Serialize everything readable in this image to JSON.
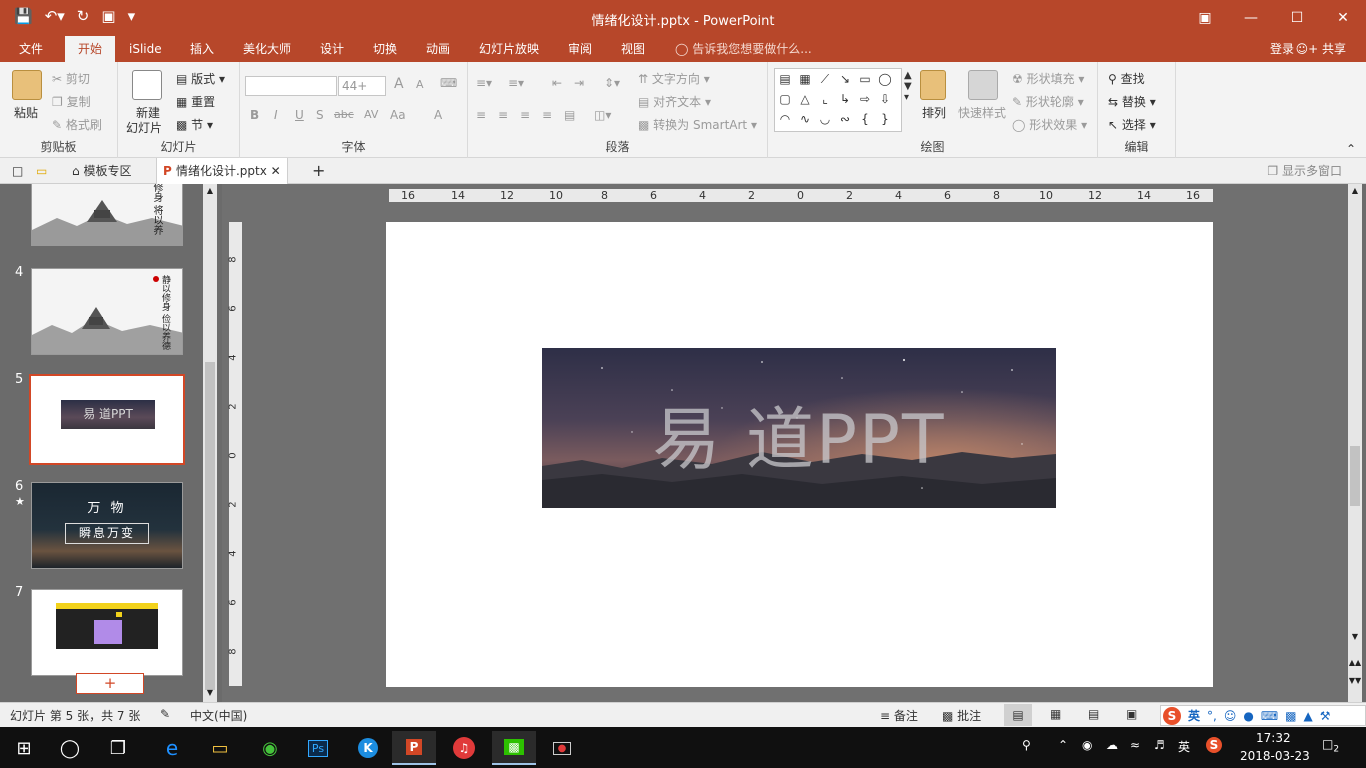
{
  "window": {
    "title": "情绪化设计.pptx - PowerPoint"
  },
  "ribbon_tabs": [
    "文件",
    "开始",
    "iSlide",
    "插入",
    "美化大师",
    "设计",
    "切换",
    "动画",
    "幻灯片放映",
    "审阅",
    "视图"
  ],
  "active_tab": "开始",
  "tell_me": "告诉我您想要做什么...",
  "account": {
    "login": "登录",
    "share": "共享"
  },
  "clipboard": {
    "paste": "粘贴",
    "cut": "剪切",
    "copy": "复制",
    "format_painter": "格式刷",
    "label": "剪贴板"
  },
  "slides_group": {
    "new_slide_line1": "新建",
    "new_slide_line2": "幻灯片",
    "layout": "版式",
    "reset": "重置",
    "section": "节",
    "label": "幻灯片"
  },
  "font_group": {
    "font_size": "44+",
    "label": "字体",
    "bold": "B",
    "italic": "I",
    "underline": "U",
    "shadow": "S",
    "strike": "abc",
    "spacing": "AV",
    "case": "Aa",
    "color": "A",
    "grow": "A",
    "shrink": "A"
  },
  "paragraph_group": {
    "text_direction": "文字方向",
    "align_text": "对齐文本",
    "convert_smartart": "转换为 SmartArt",
    "label": "段落"
  },
  "drawing_group": {
    "arrange": "排列",
    "quick_styles": "快速样式",
    "shape_fill": "形状填充",
    "shape_outline": "形状轮廓",
    "shape_effects": "形状效果",
    "label": "绘图"
  },
  "editing_group": {
    "find": "查找",
    "replace": "替换",
    "select": "选择",
    "label": "编辑"
  },
  "doc_tabs": {
    "templates": "模板专区",
    "file": "情绪化设计.pptx",
    "multi_window": "显示多窗口",
    "new_tab": "+"
  },
  "thumbnails": [
    {
      "num": "",
      "kind": "ink-landscape",
      "poem": "将以修身 将以养德"
    },
    {
      "num": "4",
      "kind": "ink-landscape",
      "poem": "静以修身 俭以养德"
    },
    {
      "num": "5",
      "kind": "banner",
      "text": "易 道PPT",
      "active": true
    },
    {
      "num": "6",
      "kind": "dusk",
      "title": "万 物",
      "subtitle": "瞬息万变",
      "star": "★"
    },
    {
      "num": "7",
      "kind": "screenshot"
    }
  ],
  "add_slide": "+",
  "ruler": {
    "h_ticks": [
      "16",
      "14",
      "12",
      "10",
      "8",
      "6",
      "4",
      "2",
      "0",
      "2",
      "4",
      "6",
      "8",
      "10",
      "12",
      "14",
      "16"
    ],
    "v_ticks": [
      "8",
      "6",
      "4",
      "2",
      "0",
      "2",
      "4",
      "6",
      "8"
    ]
  },
  "slide": {
    "banner_text": "易 道PPT"
  },
  "status": {
    "slide_info": "幻灯片 第 5 张，共 7 张",
    "language": "中文(中国)",
    "notes": "备注",
    "comments": "批注"
  },
  "ime": {
    "lang": "英",
    "mode": "英"
  },
  "clock": {
    "time": "17:32",
    "date": "2018-03-23"
  },
  "notifications": "2",
  "colors": {
    "accent": "#b7472a",
    "selection": "#d24726"
  }
}
